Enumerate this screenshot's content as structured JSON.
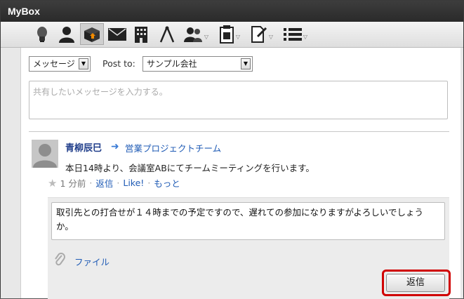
{
  "app": {
    "title": "MyBox"
  },
  "toolbar": {
    "icons": [
      "lightbulb-icon",
      "person-icon",
      "box-icon",
      "mail-icon",
      "building-icon",
      "compass-icon",
      "people-icon",
      "document-icon",
      "edit-document-icon",
      "list-icon"
    ]
  },
  "post_form": {
    "type_selected": "メッセージ",
    "post_to_label": "Post to:",
    "post_to_selected": "サンプル会社",
    "message_placeholder": "共有したいメッセージを入力する。"
  },
  "feed_item": {
    "author": "青柳辰巳",
    "group": "営業プロジェクトチーム",
    "message": "本日14時より、会議室ABにてチームミーティングを行います。",
    "time": "1 分前",
    "actions": {
      "reply": "返信",
      "like": "Like!",
      "more": "もっと"
    }
  },
  "reply": {
    "text": "取引先との打合せが１４時までの予定ですので、遅れての参加になりますがよろしいでしょうか。",
    "file_label": "ファイル",
    "submit_label": "返信"
  }
}
